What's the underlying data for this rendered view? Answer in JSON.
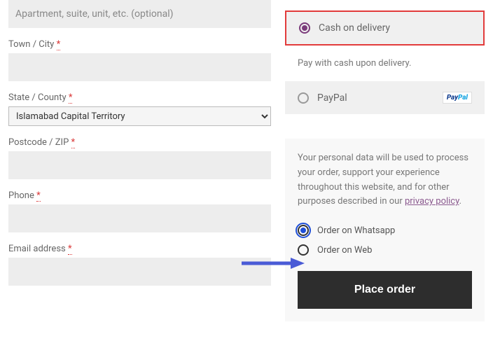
{
  "billing": {
    "apt_placeholder": "Apartment, suite, unit, etc. (optional)",
    "town_label": "Town / City",
    "town_value": "",
    "state_label": "State / County",
    "state_value": "Islamabad Capital Territory",
    "postcode_label": "Postcode / ZIP",
    "postcode_value": "",
    "phone_label": "Phone",
    "phone_value": "",
    "email_label": "Email address",
    "email_value": "",
    "required_mark": "*"
  },
  "payment": {
    "options": [
      {
        "label": "Cash on delivery",
        "selected": true
      },
      {
        "label": "PayPal",
        "selected": false
      }
    ],
    "cod_desc": "Pay with cash upon delivery."
  },
  "privacy": {
    "text": "Your personal data will be used to process your order, support your experience throughout this website, and for other purposes described in our ",
    "link_text": "privacy policy",
    "suffix": "."
  },
  "order_channel": {
    "options": [
      {
        "label": "Order on Whatsapp",
        "selected": true
      },
      {
        "label": "Order on Web",
        "selected": false
      }
    ]
  },
  "actions": {
    "place_order": "Place order"
  }
}
